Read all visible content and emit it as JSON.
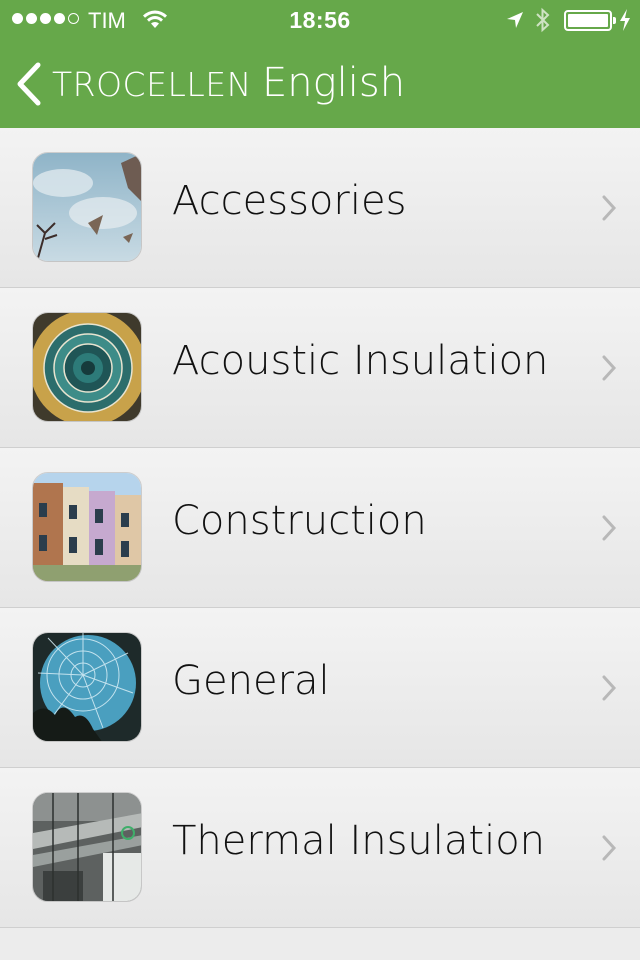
{
  "status_bar": {
    "carrier": "TIM",
    "time": "18:56",
    "signal_bars_filled": 4,
    "signal_bars_total": 5,
    "battery_charge": 1.0
  },
  "navbar": {
    "back_label": "TROCELLEN",
    "title": "English",
    "background_color": "#66a84a"
  },
  "list": {
    "items": [
      {
        "label": "Accessories",
        "icon": "sky-kites-thumbnail"
      },
      {
        "label": "Acoustic Insulation",
        "icon": "spiral-staircase-thumbnail"
      },
      {
        "label": "Construction",
        "icon": "townhouses-thumbnail"
      },
      {
        "label": "General",
        "icon": "glass-dome-thumbnail"
      },
      {
        "label": "Thermal Insulation",
        "icon": "ducts-ceiling-thumbnail"
      }
    ]
  }
}
